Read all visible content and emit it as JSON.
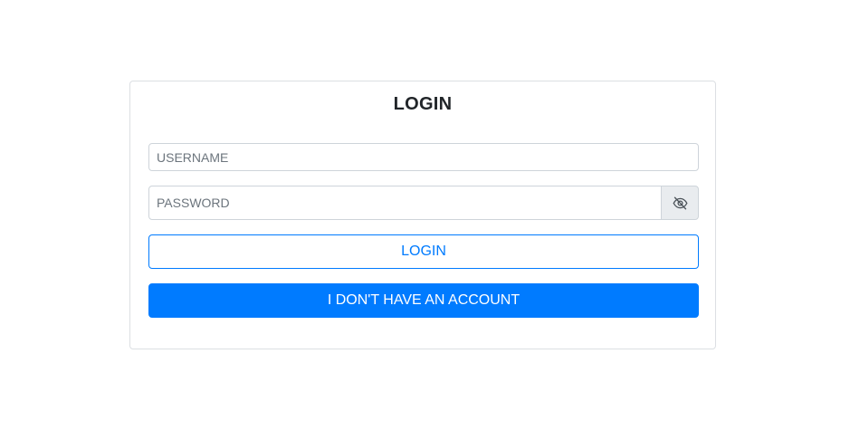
{
  "login_form": {
    "title": "LOGIN",
    "username": {
      "placeholder": "USERNAME",
      "value": ""
    },
    "password": {
      "placeholder": "PASSWORD",
      "value": "",
      "toggle_icon": "eye-slash-icon"
    },
    "login_button_label": "LOGIN",
    "register_button_label": "I DON'T HAVE AN ACCOUNT"
  },
  "colors": {
    "primary": "#007bff",
    "border": "#ced4da",
    "addon_bg": "#e9ecef"
  }
}
